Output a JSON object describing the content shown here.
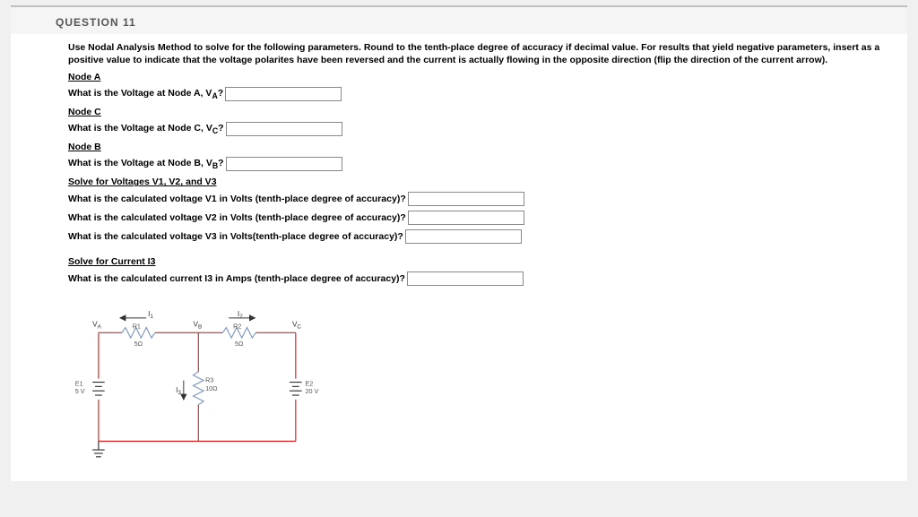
{
  "question": {
    "number": "QUESTION 11",
    "instructions": "Use Nodal Analysis Method to solve for the following parameters.  Round to the tenth-place degree of accuracy if decimal value.  For results that yield negative parameters, insert as a positive value to indicate that the voltage polarites have been reversed and the current is actually flowing in the opposite direction (flip the direction of the current arrow).",
    "sections": {
      "nodeA": {
        "label": "Node A",
        "prompt": "What is the Voltage at Node A, V",
        "sub": "A",
        "after": "?"
      },
      "nodeC": {
        "label": "Node C",
        "prompt": "What is the Voltage at Node C, V",
        "sub": "C",
        "after": "?"
      },
      "nodeB": {
        "label": "Node  B",
        "prompt": "What is the Voltage at Node B, V",
        "sub": "B",
        "after": "?"
      },
      "v123": {
        "label": "Solve for Voltages V1, V2, and V3",
        "v1": "What is the calculated voltage V1 in Volts (tenth-place degree of accuracy)?",
        "v2": "What is the calculated voltage V2 in Volts (tenth-place degree of accuracy)?",
        "v3": "What is the calculated voltage V3 in Volts(tenth-place degree of accuracy)?"
      },
      "i3": {
        "label": "Solve for Current I3",
        "prompt": "What is the calculated current I3 in Amps (tenth-place degree of accuracy)?"
      }
    }
  },
  "circuit": {
    "nodes": {
      "VA": "V",
      "VAs": "A",
      "VB": "V",
      "VBs": "B",
      "VC": "V",
      "VCs": "C"
    },
    "currents": {
      "I1": "I",
      "I1s": "1",
      "I2": "I",
      "I2s": "2",
      "I3": "I",
      "I3s": "3"
    },
    "r1": {
      "name": "R1",
      "value": "5Ω"
    },
    "r2": {
      "name": "R2",
      "value": "5Ω"
    },
    "r3": {
      "name": "R3",
      "value": "10Ω"
    },
    "e1": {
      "name": "E1",
      "value": "5 V"
    },
    "e2": {
      "name": "E2",
      "value": "20 V"
    }
  }
}
